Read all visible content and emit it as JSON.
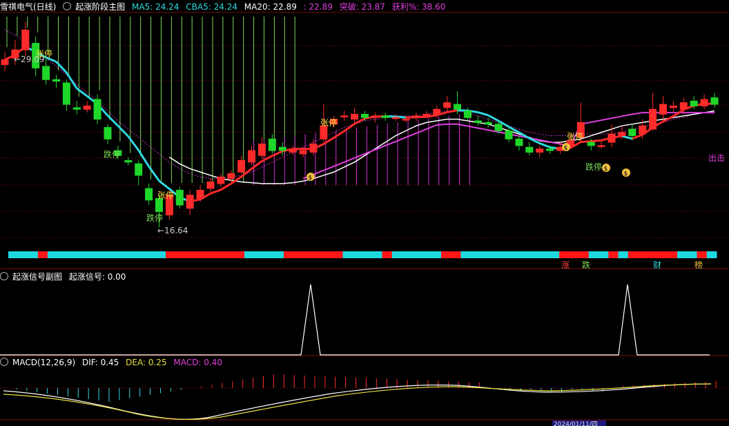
{
  "main_header": {
    "stock": "雪祺电气(日线)",
    "indicator": "起涨阶段主图",
    "ma5": "MA5: 24.24",
    "cba5": "CBA5: 24.24",
    "ma20": "MA20: 22.89",
    "val": ": 22.89",
    "tupo": "突破: 23.87",
    "huoli": "获利%: 38.60"
  },
  "sub1_header": {
    "name": "起涨信号副图",
    "value": "起涨信号: 0.00"
  },
  "macd_header": {
    "name": "MACD(12,26,9)",
    "dif": "DIF: 0.45",
    "dea": "DEA: 0.25",
    "macd": "MACD: 0.40"
  },
  "annotations": {
    "high_price": "←29.09",
    "low_price": "←16.64",
    "zhangting": "张停",
    "dieting": "跌停",
    "chuji": "出击"
  },
  "signal_bar_labels": {
    "zhang": "涨",
    "die": "跌",
    "cai": "财",
    "bang": "榜"
  },
  "bottom_date": "2024/01/11/四",
  "colors": {
    "up": "#ff2a2a",
    "down": "#1fd62a",
    "cyan": "#2fd9e0",
    "white": "#ffffff",
    "magenta": "#e040e0",
    "yellow": "#e8e040",
    "bg": "#000000"
  },
  "chart_data": {
    "type": "candlestick",
    "price_high": 29.09,
    "price_low": 16.64,
    "candles": [
      [
        26.5,
        26.8,
        27.3,
        26.1
      ],
      [
        26.9,
        27.4,
        28.0,
        26.5
      ],
      [
        27.4,
        28.6,
        29.09,
        27.0
      ],
      [
        27.8,
        26.3,
        28.2,
        25.8
      ],
      [
        26.4,
        25.6,
        26.9,
        25.3
      ],
      [
        25.6,
        25.5,
        25.9,
        25.1
      ],
      [
        25.4,
        24.1,
        25.6,
        23.7
      ],
      [
        23.9,
        23.8,
        24.3,
        23.5
      ],
      [
        23.8,
        24.0,
        24.3,
        23.6
      ],
      [
        24.4,
        23.2,
        24.7,
        22.9
      ],
      [
        22.7,
        22.0,
        22.9,
        21.7
      ],
      [
        21.3,
        21.0,
        21.6,
        20.8
      ],
      [
        20.7,
        20.6,
        20.9,
        20.4
      ],
      [
        20.5,
        19.8,
        20.7,
        19.2
      ],
      [
        19.0,
        18.3,
        19.3,
        18.0
      ],
      [
        18.4,
        17.6,
        18.6,
        16.64
      ],
      [
        17.4,
        18.6,
        18.9,
        17.1
      ],
      [
        18.9,
        18.0,
        19.1,
        17.8
      ],
      [
        17.8,
        18.6,
        18.9,
        17.4
      ],
      [
        18.4,
        18.9,
        19.2,
        18.2
      ],
      [
        19.0,
        19.4,
        19.6,
        18.8
      ],
      [
        19.3,
        19.7,
        19.9,
        19.1
      ],
      [
        19.6,
        19.9,
        20.1,
        19.4
      ],
      [
        20.0,
        20.7,
        21.0,
        19.9
      ],
      [
        20.6,
        21.3,
        21.6,
        20.4
      ],
      [
        21.0,
        21.7,
        22.1,
        20.8
      ],
      [
        22.0,
        21.3,
        22.3,
        21.1
      ],
      [
        21.5,
        21.3,
        21.8,
        21.0
      ],
      [
        21.2,
        21.4,
        21.6,
        21.0
      ],
      [
        21.1,
        21.3,
        21.5,
        20.9
      ],
      [
        21.2,
        21.7,
        22.0,
        21.0
      ],
      [
        22.0,
        22.8,
        24.1,
        21.8
      ],
      [
        22.9,
        23.2,
        23.4,
        22.7
      ],
      [
        23.4,
        23.4,
        23.7,
        23.1
      ],
      [
        23.2,
        23.5,
        23.9,
        22.9
      ],
      [
        23.5,
        23.3,
        23.7,
        23.1
      ],
      [
        23.3,
        23.4,
        23.6,
        23.0
      ],
      [
        23.4,
        23.3,
        23.6,
        23.1
      ],
      [
        23.3,
        23.3,
        23.5,
        23.1
      ],
      [
        23.2,
        23.2,
        23.4,
        23.0
      ],
      [
        23.3,
        23.4,
        23.6,
        23.1
      ],
      [
        23.4,
        23.5,
        23.7,
        23.3
      ],
      [
        23.5,
        23.8,
        24.0,
        23.3
      ],
      [
        23.9,
        24.2,
        24.6,
        23.6
      ],
      [
        24.1,
        23.8,
        24.9,
        23.5
      ],
      [
        23.7,
        23.3,
        23.9,
        23.1
      ],
      [
        23.1,
        23.0,
        23.4,
        22.8
      ],
      [
        23.0,
        22.9,
        23.3,
        22.7
      ],
      [
        22.9,
        22.5,
        23.1,
        22.3
      ],
      [
        22.5,
        22.0,
        22.7,
        21.8
      ],
      [
        22.0,
        21.6,
        22.2,
        21.3
      ],
      [
        21.5,
        21.2,
        21.8,
        21.0
      ],
      [
        21.2,
        21.4,
        21.6,
        20.9
      ],
      [
        21.4,
        21.3,
        21.6,
        21.1
      ],
      [
        21.3,
        21.5,
        21.8,
        21.1
      ],
      [
        21.6,
        21.9,
        22.3,
        21.4
      ],
      [
        22.1,
        23.0,
        24.2,
        21.8
      ],
      [
        21.8,
        21.6,
        22.0,
        21.3
      ],
      [
        21.6,
        21.6,
        21.9,
        21.4
      ],
      [
        21.8,
        22.3,
        22.9,
        21.5
      ],
      [
        22.2,
        22.4,
        22.8,
        22.0
      ],
      [
        22.6,
        22.2,
        22.9,
        21.9
      ],
      [
        22.3,
        22.8,
        23.2,
        22.0
      ],
      [
        22.6,
        23.8,
        24.8,
        22.5
      ],
      [
        23.5,
        24.1,
        24.6,
        23.2
      ],
      [
        23.9,
        24.0,
        24.3,
        23.6
      ],
      [
        23.8,
        24.2,
        24.5,
        23.5
      ],
      [
        24.3,
        24.0,
        24.6,
        23.8
      ],
      [
        24.0,
        24.4,
        24.7,
        23.8
      ],
      [
        24.5,
        24.1,
        24.8,
        23.9
      ]
    ],
    "signal_segments": [
      "c",
      "c",
      "c",
      "r",
      "c",
      "c",
      "c",
      "c",
      "c",
      "c",
      "c",
      "c",
      "c",
      "c",
      "c",
      "c",
      "r",
      "r",
      "r",
      "r",
      "r",
      "r",
      "r",
      "r",
      "c",
      "c",
      "c",
      "c",
      "r",
      "r",
      "r",
      "r",
      "r",
      "r",
      "c",
      "c",
      "c",
      "c",
      "r",
      "c",
      "c",
      "c",
      "c",
      "c",
      "r",
      "r",
      "c",
      "c",
      "c",
      "c",
      "c",
      "c",
      "c",
      "c",
      "c",
      "c",
      "r",
      "r",
      "r",
      "c",
      "c",
      "r",
      "c",
      "r",
      "r",
      "r",
      "r",
      "r",
      "c",
      "c",
      "r",
      "c"
    ],
    "signal_spikes": [
      29,
      60
    ],
    "macd": {
      "dif": 0.45,
      "dea": 0.25,
      "macd": 0.4
    }
  }
}
